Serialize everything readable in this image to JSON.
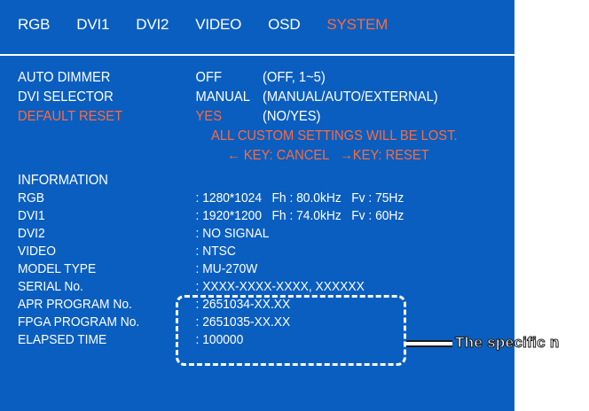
{
  "menu": {
    "items": [
      "RGB",
      "DVI1",
      "DVI2",
      "VIDEO",
      "OSD",
      "SYSTEM"
    ],
    "active": "SYSTEM"
  },
  "settings": {
    "auto_dimmer": {
      "label": "AUTO DIMMER",
      "value": "OFF",
      "options": "(OFF, 1~5)"
    },
    "dvi_selector": {
      "label": "DVI SELECTOR",
      "value": "MANUAL",
      "options": "(MANUAL/AUTO/EXTERNAL)"
    },
    "default_reset": {
      "label": "DEFAULT RESET",
      "value": "YES",
      "options": "(NO/YES)"
    },
    "warning": "ALL CUSTOM SETTINGS WILL BE LOST.",
    "keys": "← KEY: CANCEL   →KEY: RESET"
  },
  "information": {
    "heading": "INFORMATION",
    "rows": [
      {
        "label": "RGB",
        "value": ": 1280*1024   Fh : 80.0kHz   Fv : 75Hz"
      },
      {
        "label": "DVI1",
        "value": ": 1920*1200   Fh : 74.0kHz   Fv : 60Hz"
      },
      {
        "label": "DVI2",
        "value": ": NO SIGNAL"
      },
      {
        "label": "VIDEO",
        "value": ": NTSC"
      },
      {
        "label": "MODEL TYPE",
        "value": ": MU-270W"
      },
      {
        "label": "SERIAL No.",
        "value": ": XXXX-XXXX-XXXX, XXXXXX"
      },
      {
        "label": "APR PROGRAM No.",
        "value": ": 2651034-XX.XX"
      },
      {
        "label": "FPGA PROGRAM No.",
        "value": ": 2651035-XX.XX"
      },
      {
        "label": "ELAPSED TIME",
        "value": ": 100000"
      }
    ]
  },
  "callout": {
    "text": "The specific n"
  },
  "colors": {
    "background": "#0a5ec0",
    "accent": "#ff6a3a",
    "text": "#ffffff"
  }
}
